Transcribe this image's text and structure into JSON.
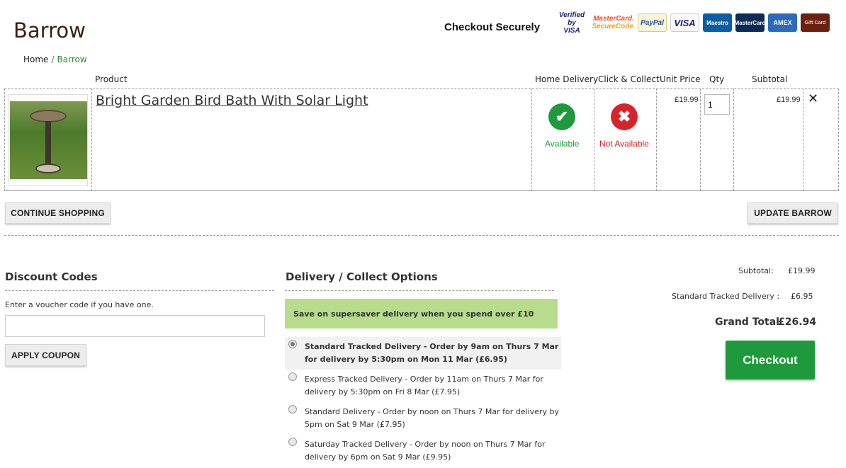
{
  "header": {
    "title": "Barrow",
    "checkout_securely": "Checkout Securely",
    "payment_logos": {
      "vbv_line1": "Verified by",
      "vbv_line2": "VISA",
      "mc_line1": "MasterCard.",
      "mc_line2": "SecureCode.",
      "paypal": "PayPal",
      "visa": "VISA",
      "maestro": "Maestro",
      "mastercard": "MasterCard",
      "amex": "AMEX",
      "gift": "Gift Card"
    }
  },
  "breadcrumb": {
    "home": "Home",
    "separator": "/",
    "current": "Barrow"
  },
  "table": {
    "headers": {
      "product": "Product",
      "home_delivery": "Home Delivery",
      "click_collect": "Click & Collect",
      "unit_price": "Unit Price",
      "qty": "Qty",
      "subtotal": "Subtotal"
    },
    "row": {
      "name": "Bright Garden Bird Bath With Solar Light",
      "home_delivery_status": "Available",
      "click_collect_status": "Not Available",
      "unit_price": "£19.99",
      "qty": "1",
      "subtotal": "£19.99",
      "remove": "✕"
    }
  },
  "buttons": {
    "continue_shopping": "CONTINUE SHOPPING",
    "update_barrow": "UPDATE BARROW",
    "apply_coupon": "APPLY COUPON",
    "checkout": "Checkout"
  },
  "discount": {
    "title": "Discount Codes",
    "hint": "Enter a voucher code if you have one.",
    "value": ""
  },
  "delivery": {
    "title": "Delivery / Collect Options",
    "promo": "Save on supersaver delivery when you spend over £10",
    "options": [
      {
        "label": "Standard Tracked Delivery - Order by 9am on Thurs 7 Mar for delivery by 5:30pm on Mon 11 Mar (£6.95)",
        "selected": true
      },
      {
        "label": "Express Tracked Delivery - Order by 11am on Thurs 7 Mar for delivery by 5:30pm on Fri 8 Mar (£7.95)",
        "selected": false
      },
      {
        "label": "Standard Delivery - Order by noon on Thurs 7 Mar for delivery by 5pm on Sat 9 Mar (£7.95)",
        "selected": false
      },
      {
        "label": "Saturday Tracked Delivery - Order by noon on Thurs 7 Mar for delivery by 6pm on Sat 9 Mar (£9.95)",
        "selected": false
      }
    ]
  },
  "summary": {
    "subtotal_label": "Subtotal:",
    "subtotal_value": "£19.99",
    "delivery_label": "Standard Tracked Delivery :",
    "delivery_value": "£6.95",
    "grand_total_label": "Grand Total",
    "grand_total_value": "£26.94"
  },
  "colors": {
    "accent_green": "#1e9a3c",
    "error_red": "#d8232a",
    "promo_green": "#b7dc8c",
    "title_brown": "#3b1f12"
  }
}
